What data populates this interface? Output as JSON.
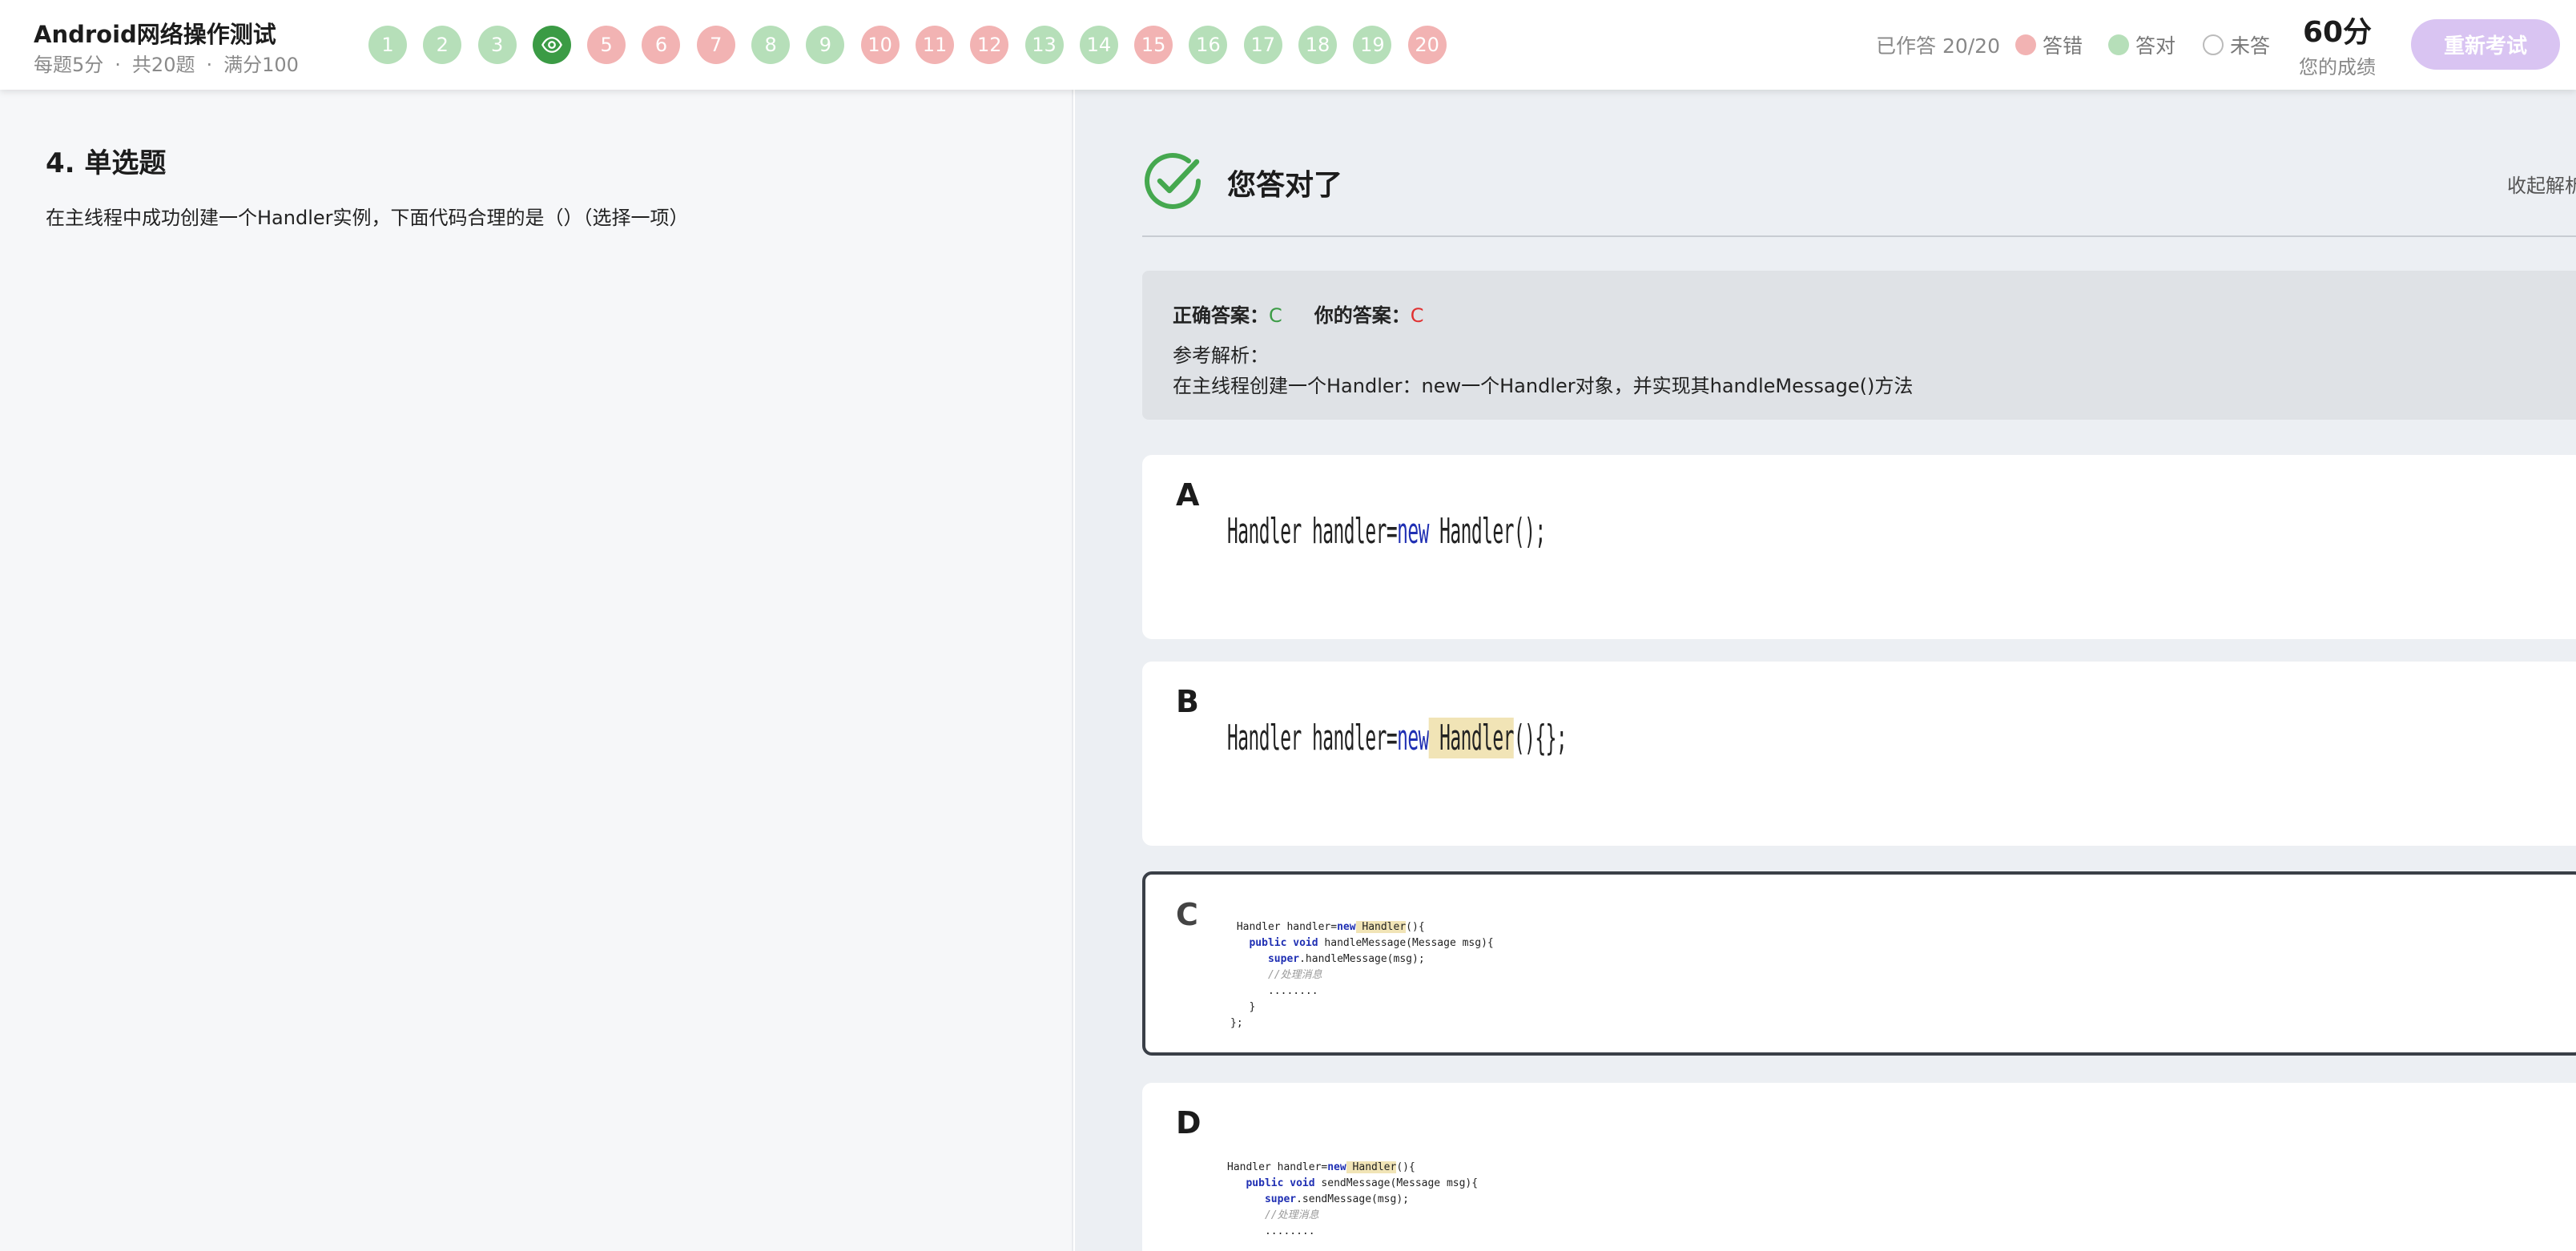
{
  "header": {
    "title": "Android网络操作测试",
    "meta": {
      "per_question": "每题5分",
      "total": "共20题",
      "full_score": "满分100"
    },
    "questions": [
      {
        "num": "1",
        "status": "correct"
      },
      {
        "num": "2",
        "status": "correct"
      },
      {
        "num": "3",
        "status": "correct"
      },
      {
        "num": "4",
        "status": "current"
      },
      {
        "num": "5",
        "status": "wrong"
      },
      {
        "num": "6",
        "status": "wrong"
      },
      {
        "num": "7",
        "status": "wrong"
      },
      {
        "num": "8",
        "status": "correct"
      },
      {
        "num": "9",
        "status": "correct"
      },
      {
        "num": "10",
        "status": "wrong"
      },
      {
        "num": "11",
        "status": "wrong"
      },
      {
        "num": "12",
        "status": "wrong"
      },
      {
        "num": "13",
        "status": "correct"
      },
      {
        "num": "14",
        "status": "correct"
      },
      {
        "num": "15",
        "status": "wrong"
      },
      {
        "num": "16",
        "status": "correct"
      },
      {
        "num": "17",
        "status": "correct"
      },
      {
        "num": "18",
        "status": "correct"
      },
      {
        "num": "19",
        "status": "correct"
      },
      {
        "num": "20",
        "status": "wrong"
      }
    ],
    "answered": "已作答 20/20",
    "legend": {
      "wrong": "答错",
      "right": "答对",
      "unanswered": "未答"
    },
    "score": "60分",
    "score_label": "您的成绩",
    "retake_button": "重新考试"
  },
  "question": {
    "type_label": "4. 单选题",
    "text": "在主线程中成功创建一个Handler实例，下面代码合理的是（）（选择一项）"
  },
  "result": {
    "status_text": "您答对了",
    "collapse_label": "收起解析",
    "correct_answer_label": "正确答案：",
    "correct_answer": "C",
    "your_answer_label": "你的答案：",
    "your_answer": "C",
    "analysis_label": "参考解析：",
    "analysis_text": "在主线程创建一个Handler：new一个Handler对象，并实现其handleMessage()方法"
  },
  "options": [
    {
      "letter": "A",
      "code": [
        "Handler handler=",
        "new",
        " Handler();"
      ]
    },
    {
      "letter": "B",
      "code": [
        "Handler handler=",
        "new",
        " Handler",
        "(){};"
      ]
    },
    {
      "letter": "C",
      "selected": true,
      "lines": [
        "Handler handler=",
        "new",
        " Handler",
        "(){",
        "public",
        " ",
        "void",
        " handleMessage(Message msg){",
        "super",
        ".handleMessage(msg);",
        "//处理消息",
        "........",
        "}",
        "};"
      ]
    },
    {
      "letter": "D",
      "lines": [
        "Handler handler=",
        "new",
        " Handler",
        "(){",
        "public",
        " ",
        "void",
        " sendMessage(Message msg){",
        "super",
        ".sendMessage(msg);",
        "//处理消息",
        "........"
      ]
    }
  ],
  "colors": {
    "correct": "#b6dfb9",
    "wrong": "#f2b3b3",
    "current": "#3b9b45",
    "accent_button": "#d9c4f2"
  }
}
